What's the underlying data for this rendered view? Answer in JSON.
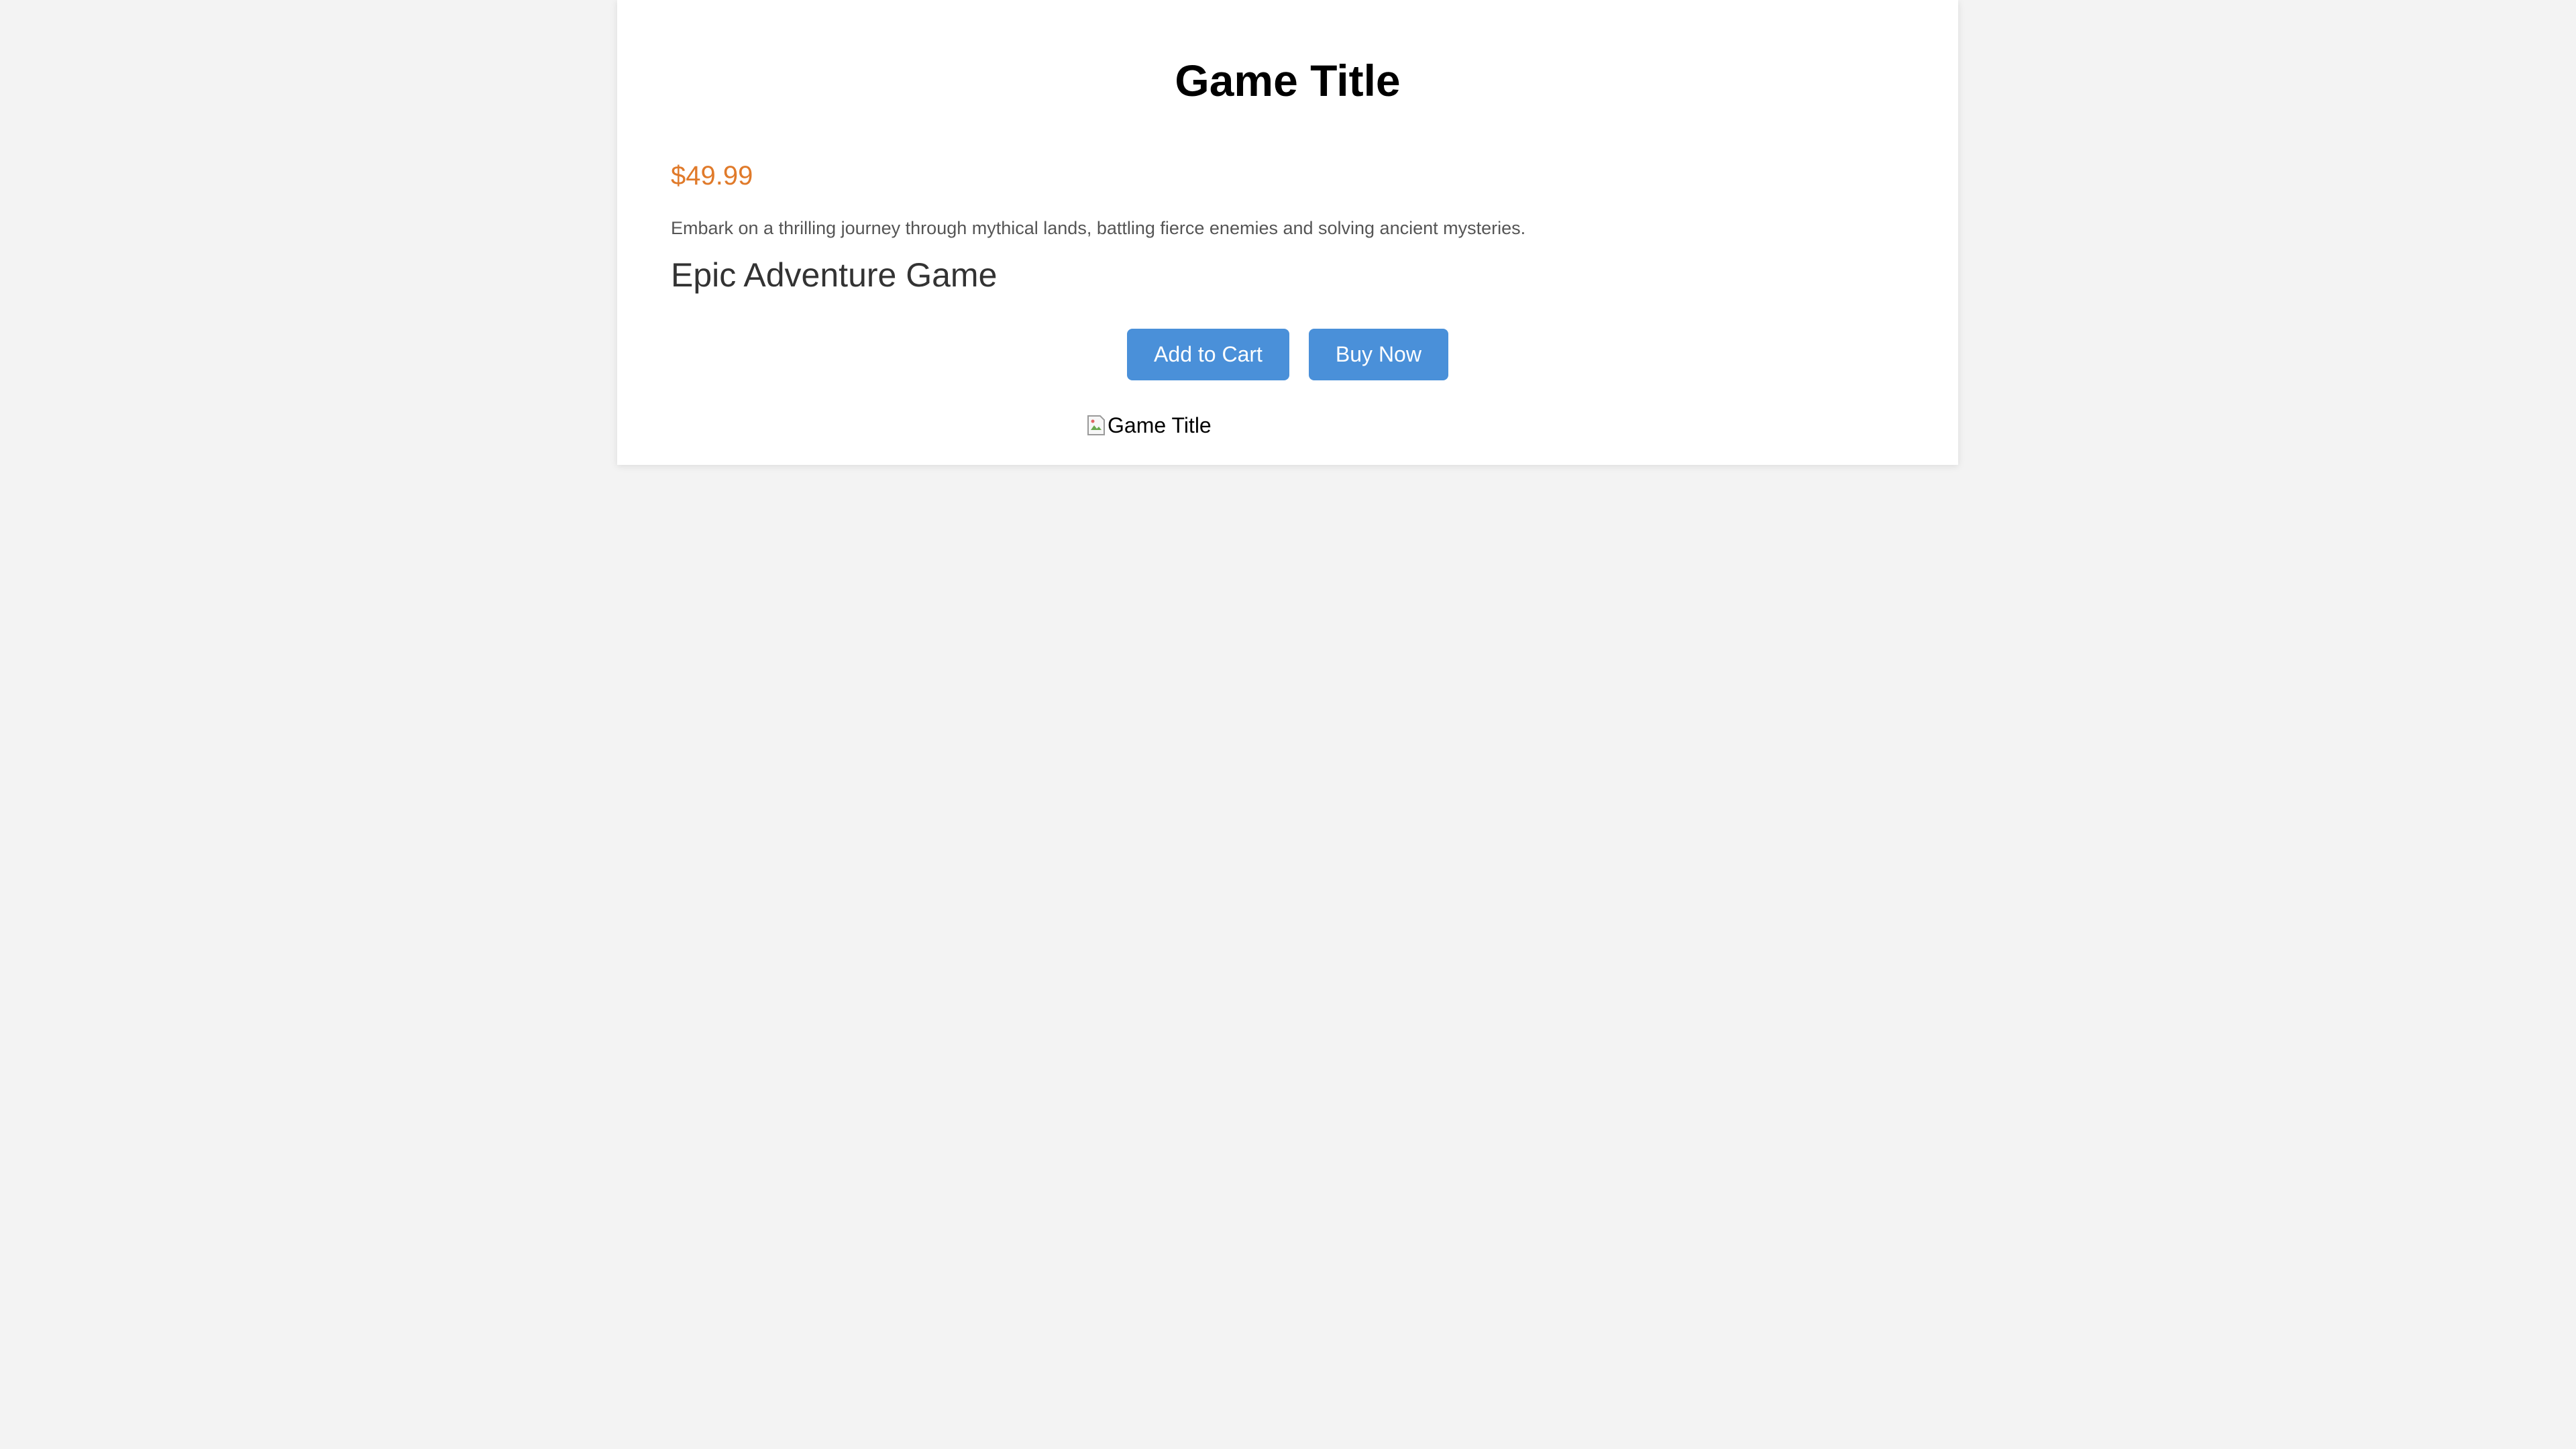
{
  "page": {
    "heading": "Game Title",
    "price": "$49.99",
    "description": "Embark on a thrilling journey through mythical lands, battling fierce enemies and solving ancient mysteries.",
    "subtitle": "Epic Adventure Game",
    "image_alt": "Game Title"
  },
  "buttons": {
    "add_to_cart": "Add to Cart",
    "buy_now": "Buy Now"
  },
  "icons": {
    "image_placeholder": "broken-image-icon"
  },
  "colors": {
    "background": "#f3f3f3",
    "card": "#ffffff",
    "price": "#e07a2a",
    "button": "#4a90d9",
    "description": "#555555",
    "subtitle": "#333333"
  }
}
